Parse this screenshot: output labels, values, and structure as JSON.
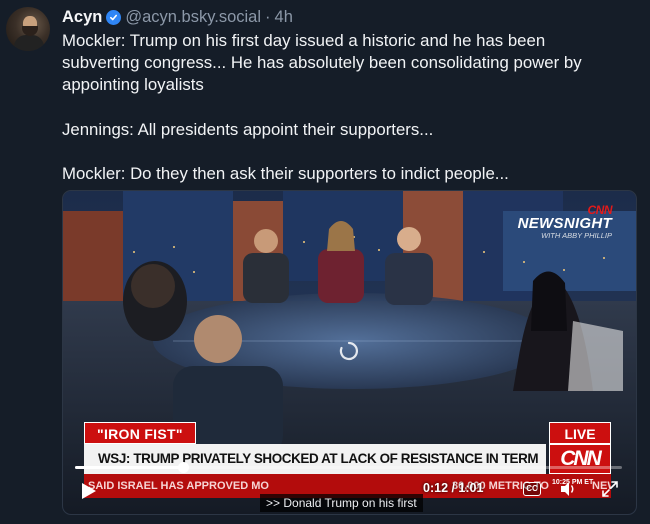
{
  "post": {
    "author": "Acyn",
    "handle": "@acyn.bsky.social",
    "separator": "·",
    "time": "4h",
    "paragraphs": [
      "Mockler: Trump on his first day issued a historic and he has been subverting congress... He has absolutely been consolidating power by appointing loyalists",
      "Jennings: All presidents appoint their supporters...",
      "Mockler: Do they then ask their supporters to indict people..."
    ]
  },
  "video": {
    "logo_cnn": "CNN",
    "logo_show": "NEWSNIGHT",
    "logo_sub": "WITH ABBY PHILLIP",
    "chyron_tag": "\"IRON FIST\"",
    "live_label": "LIVE",
    "headline": "WSJ: TRUMP PRIVATELY SHOCKED AT LACK OF RESISTANCE IN TERM",
    "network": "CNN",
    "ticker": "SAID ISRAEL HAS APPROVED MO",
    "ticker_tail": "30,000 METRIC TO",
    "ticker_end": "NEWSNIGH",
    "clock": "10:25 PM ET",
    "caption": ">> Donald Trump on his first",
    "timecode": "0:12 / 1:01",
    "progress": 0.197,
    "cc_label": "CC"
  },
  "colors": {
    "background": "#151d28",
    "text": "#f1f3f5",
    "muted": "#8c98a8",
    "verified": "#2f86f6",
    "cnn_red": "#cc0f0f"
  },
  "icons": [
    "verified-badge-icon",
    "play-icon",
    "loading-spinner-icon",
    "closed-captions-icon",
    "volume-icon",
    "fullscreen-icon"
  ]
}
